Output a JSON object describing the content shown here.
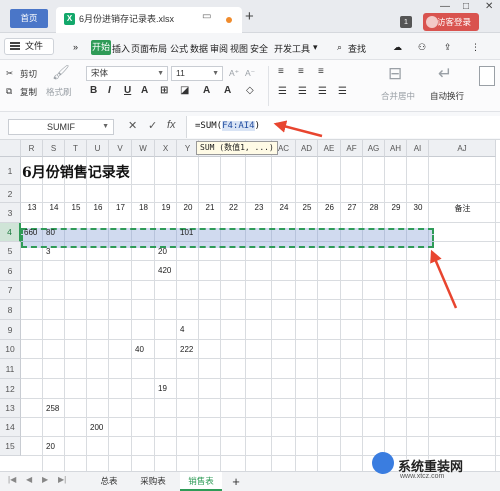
{
  "titlebar": {
    "home_tab": "首页",
    "file_icon": "X",
    "file_title": "6月份进销存记录表.xlsx",
    "new_tab": "+",
    "window_badge": "1",
    "login": "访客登录",
    "controls": [
      "—",
      "□",
      "✕"
    ]
  },
  "menubar": {
    "file_menu": "文件",
    "more": "»",
    "items": [
      "开始",
      "插入",
      "页面布局",
      "公式",
      "数据",
      "审阅",
      "视图",
      "安全",
      "开发工具"
    ],
    "search": "查找"
  },
  "ribbon": {
    "cut": "剪切",
    "copy": "复制",
    "format_painter": "格式刷",
    "font_name": "宋体",
    "font_size": "11",
    "merge_center": "合并居中",
    "wrap_text": "自动换行",
    "accent": "#2f9b57"
  },
  "formula_bar": {
    "name_box": "SUMIF",
    "cancel": "✕",
    "confirm": "✓",
    "fx": "fx",
    "formula_prefix": "=SUM(",
    "formula_range": "F4:AI4",
    "formula_suffix": ")",
    "tooltip": "SUM (数值1, ...)"
  },
  "sheet": {
    "columns": [
      "R",
      "S",
      "T",
      "U",
      "V",
      "W",
      "X",
      "Y",
      "Z",
      "AA",
      "AB",
      "AC",
      "AD",
      "AE",
      "AF",
      "AG",
      "AH",
      "AI",
      "AJ"
    ],
    "rows": [
      "1",
      "2",
      "3",
      "4",
      "5",
      "6",
      "7",
      "8",
      "9",
      "10",
      "11",
      "12",
      "13",
      "14",
      "15"
    ],
    "title": "6月份销售记录表",
    "day_headers": [
      "13",
      "14",
      "15",
      "16",
      "17",
      "18",
      "19",
      "20",
      "21",
      "22",
      "23",
      "24",
      "25",
      "26",
      "27",
      "28",
      "29",
      "30"
    ],
    "remark_header": "备注",
    "cells": [
      {
        "row": "4",
        "col": "R",
        "value": "660"
      },
      {
        "row": "4",
        "col": "S",
        "value": "80"
      },
      {
        "row": "4",
        "col": "Y",
        "value": "101"
      },
      {
        "row": "5",
        "col": "S",
        "value": "3"
      },
      {
        "row": "5",
        "col": "X",
        "value": "20"
      },
      {
        "row": "6",
        "col": "X",
        "value": "420"
      },
      {
        "row": "9",
        "col": "Y",
        "value": "4"
      },
      {
        "row": "10",
        "col": "W",
        "value": "40"
      },
      {
        "row": "10",
        "col": "Y",
        "value": "222"
      },
      {
        "row": "12",
        "col": "X",
        "value": "19"
      },
      {
        "row": "13",
        "col": "S",
        "value": "258"
      },
      {
        "row": "14",
        "col": "U",
        "value": "200"
      },
      {
        "row": "15",
        "col": "S",
        "value": "20"
      }
    ],
    "selected_row": "4"
  },
  "tabs": {
    "sheets": [
      "总表",
      "采购表",
      "销售表"
    ],
    "active": "销售表",
    "add": "+"
  },
  "watermark": {
    "text": "系统重装网",
    "url": "www.xtcz.com"
  },
  "arrow_color": "#e8452f"
}
